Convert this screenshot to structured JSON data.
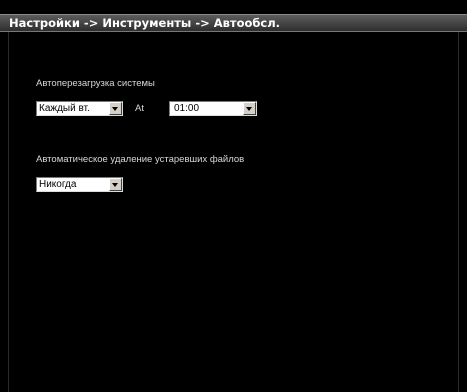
{
  "window": {
    "title": "Настройки -> Инструменты -> Автообсл."
  },
  "reboot": {
    "label": "Автоперезагрузка системы",
    "day_value": "Каждый вт.",
    "at_label": "At",
    "time_value": "01:00"
  },
  "cleanup": {
    "label": "Автоматическое удаление устаревших файлов",
    "value": "Никогда"
  },
  "colors": {
    "background": "#000000",
    "title_bar": "#3a3a3a",
    "text": "#d8d8d8"
  },
  "icons": {
    "dropdown": "chevron-down-icon"
  }
}
